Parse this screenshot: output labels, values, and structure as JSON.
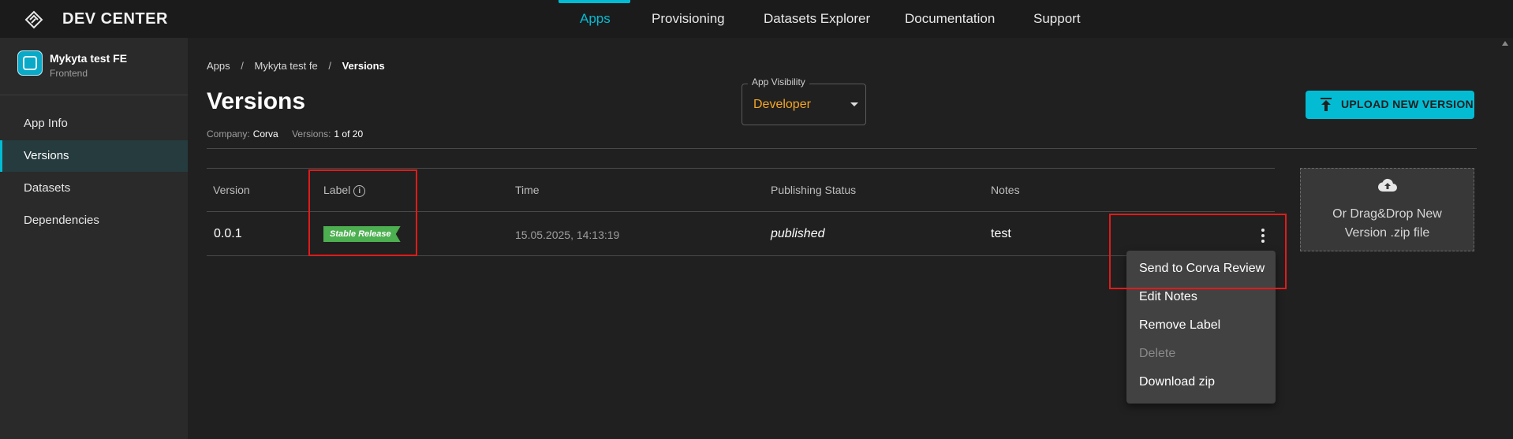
{
  "topbar": {
    "brand": "DEV CENTER",
    "nav": [
      {
        "label": "Apps",
        "active": true
      },
      {
        "label": "Provisioning",
        "active": false
      },
      {
        "label": "Datasets Explorer",
        "active": false
      },
      {
        "label": "Documentation",
        "active": false
      },
      {
        "label": "Support",
        "active": false
      }
    ]
  },
  "sidebar": {
    "app_name": "Mykyta test FE",
    "app_type": "Frontend",
    "items": [
      {
        "label": "App Info",
        "active": false
      },
      {
        "label": "Versions",
        "active": true
      },
      {
        "label": "Datasets",
        "active": false
      },
      {
        "label": "Dependencies",
        "active": false
      }
    ]
  },
  "breadcrumb": {
    "items": [
      "Apps",
      "Mykyta test fe",
      "Versions"
    ],
    "separator": "/"
  },
  "page": {
    "title": "Versions",
    "company_label": "Company:",
    "company_value": "Corva",
    "versions_label": "Versions:",
    "versions_value": "1 of 20"
  },
  "visibility": {
    "legend": "App Visibility",
    "value": "Developer"
  },
  "upload": {
    "button_label": "UPLOAD NEW VERSION",
    "drop_text_line1": "Or Drag&Drop New",
    "drop_text_line2": "Version .zip file"
  },
  "table": {
    "headers": [
      "Version",
      "Label",
      "Time",
      "Publishing Status",
      "Notes"
    ],
    "rows": [
      {
        "version": "0.0.1",
        "label": "Stable Release",
        "time": "15.05.2025, 14:13:19",
        "status": "published",
        "notes": "test"
      }
    ]
  },
  "menu": {
    "items": [
      {
        "label": "Send to Corva Review",
        "disabled": false
      },
      {
        "label": "Edit Notes",
        "disabled": false
      },
      {
        "label": "Remove Label",
        "disabled": false
      },
      {
        "label": "Delete",
        "disabled": true
      },
      {
        "label": "Download zip",
        "disabled": false
      }
    ]
  },
  "colors": {
    "accent": "#03bcd4",
    "visibility_value": "#f5a623",
    "badge": "#4caf50",
    "highlight": "#e01b1b",
    "background": "#202020"
  }
}
